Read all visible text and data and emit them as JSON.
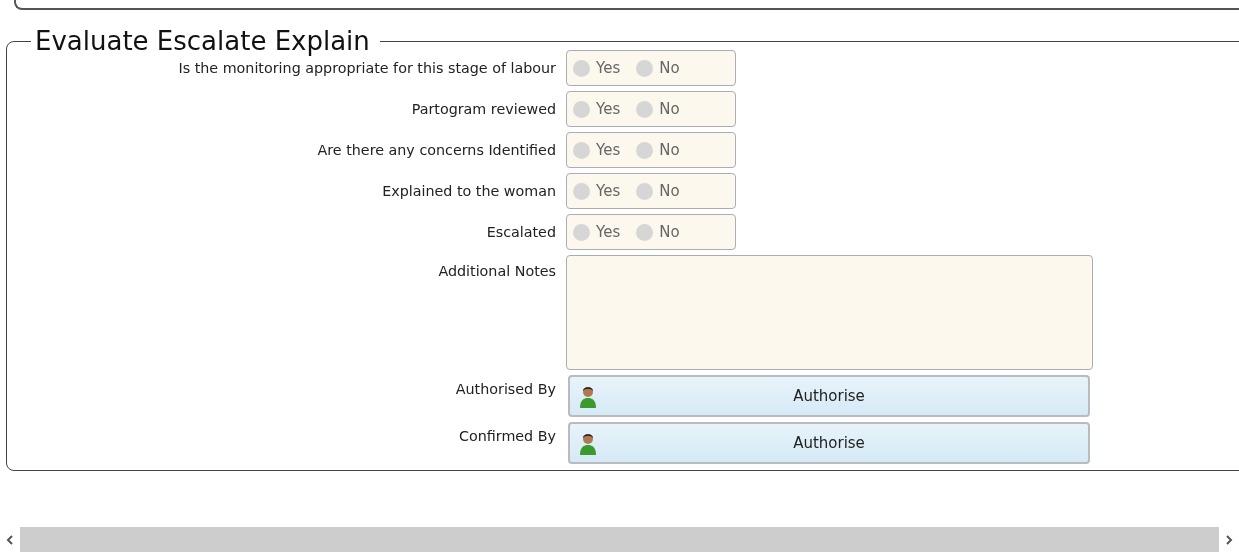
{
  "section": {
    "title": "Evaluate Escalate Explain"
  },
  "questions": [
    {
      "label": "Is the monitoring appropriate for this stage of labour",
      "options": [
        {
          "label": "Yes",
          "selected": false
        },
        {
          "label": "No",
          "selected": false
        }
      ]
    },
    {
      "label": "Partogram reviewed",
      "options": [
        {
          "label": "Yes",
          "selected": false
        },
        {
          "label": "No",
          "selected": false
        }
      ]
    },
    {
      "label": "Are there any concerns Identified",
      "options": [
        {
          "label": "Yes",
          "selected": false
        },
        {
          "label": "No",
          "selected": false
        }
      ]
    },
    {
      "label": "Explained to the woman",
      "options": [
        {
          "label": "Yes",
          "selected": false
        },
        {
          "label": "No",
          "selected": false
        }
      ]
    },
    {
      "label": "Escalated",
      "options": [
        {
          "label": "Yes",
          "selected": false
        },
        {
          "label": "No",
          "selected": false
        }
      ]
    }
  ],
  "notes": {
    "label": "Additional Notes"
  },
  "signatures": [
    {
      "label": "Authorised By",
      "button": "Authorise"
    },
    {
      "label": "Confirmed By",
      "button": "Authorise"
    }
  ]
}
